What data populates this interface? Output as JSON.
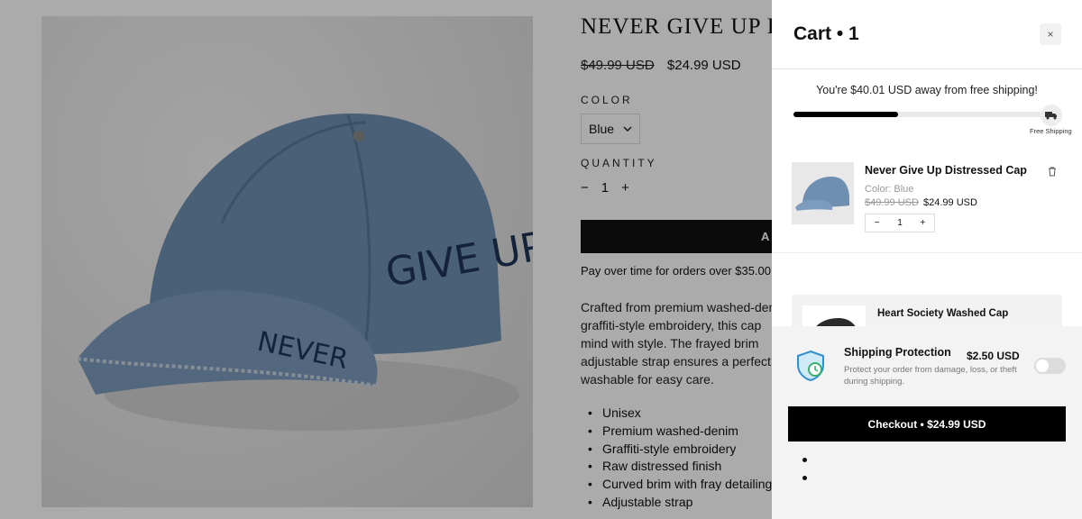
{
  "product": {
    "title": "NEVER GIVE UP DISTRESSED CAP",
    "compare_price": "$49.99 USD",
    "price": "$24.99 USD",
    "color_label": "COLOR",
    "color_value": "Blue",
    "quantity_label": "QUANTITY",
    "qty_minus": "−",
    "qty_value": "1",
    "qty_plus": "+",
    "add_button": "ADD TO CART",
    "pay_over_time": "Pay over time for orders over $35.00",
    "description": [
      "Crafted from premium washed-denim with",
      "graffiti-style embroidery, this cap",
      "mind with style. The frayed brim",
      "adjustable strap ensures a perfect fit,",
      "washable for easy care."
    ],
    "features": [
      "Unisex",
      "Premium washed-denim",
      "Graffiti-style embroidery",
      "Raw distressed finish",
      "Curved brim with fray detailing",
      "Adjustable strap"
    ]
  },
  "cart": {
    "title": "Cart • 1",
    "close_icon": "×",
    "shipping_message": "You're $40.01 USD away from free shipping!",
    "shipping_progress": 0.4,
    "free_shipping_label": "Free Shipping",
    "item": {
      "name": "Never Give Up Distressed Cap",
      "color": "Color: Blue",
      "compare_price": "$49.99 USD",
      "price": "$24.99 USD",
      "qty_minus": "−",
      "qty": "1",
      "qty_plus": "+"
    },
    "upsell": {
      "name": "Heart Society Washed Cap"
    },
    "protection": {
      "title": "Shipping Protection",
      "price": "$2.50 USD",
      "description": "Protect your order from damage, loss, or theft during shipping.",
      "enabled": false
    },
    "checkout_label": "Checkout • $24.99 USD"
  }
}
